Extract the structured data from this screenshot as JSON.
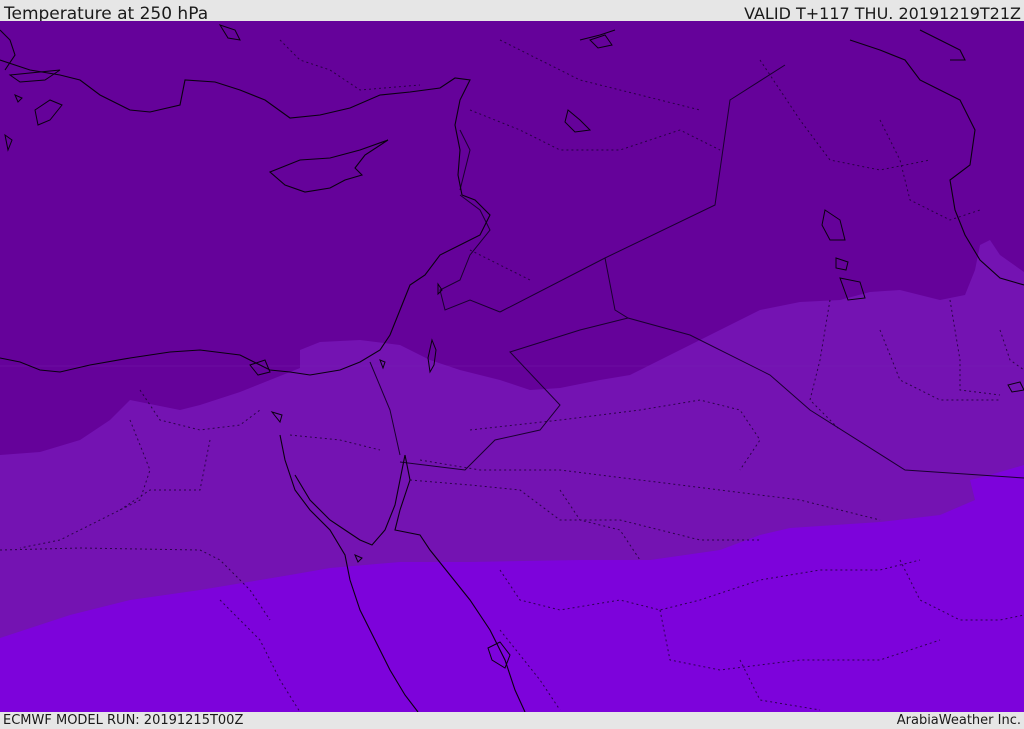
{
  "header": {
    "title": "Temperature at 250 hPa",
    "valid": "VALID T+117 THU. 20191219T21Z"
  },
  "footer": {
    "model_run": "ECMWF MODEL RUN: 20191215T00Z",
    "credit": "ArabiaWeather Inc."
  },
  "colors": {
    "band_coldest": "#65029a",
    "band_mid": "#7413b2",
    "band_warm": "#7d03db",
    "border": "#1a0030",
    "background": "#e6e6e6"
  }
}
